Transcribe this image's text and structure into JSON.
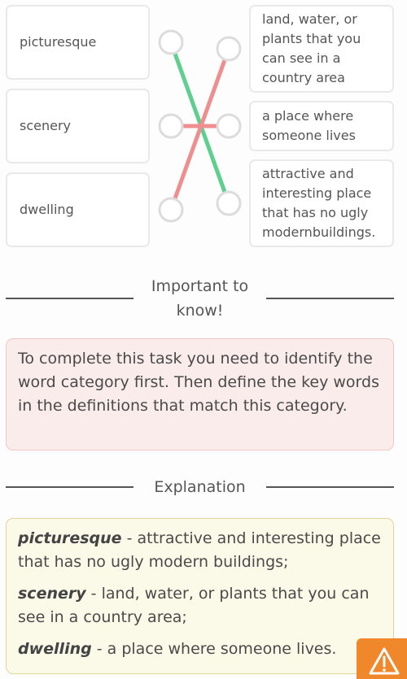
{
  "matching": {
    "terms": [
      {
        "label": "picturesque"
      },
      {
        "label": "scenery"
      },
      {
        "label": "dwelling"
      }
    ],
    "definitions": [
      {
        "label": "land, water, or plants that you can see in a country area"
      },
      {
        "label": "a place where someone lives"
      },
      {
        "label": "attractive and interesting place that has no ugly modernbuildings."
      }
    ],
    "connections": [
      {
        "term": 0,
        "definition": 2,
        "status": "correct"
      },
      {
        "term": 1,
        "definition": 1,
        "status": "incorrect"
      },
      {
        "term": 2,
        "definition": 0,
        "status": "incorrect"
      }
    ],
    "colors": {
      "correct": "#5fcf8f",
      "incorrect": "#ee8e8e"
    }
  },
  "important": {
    "heading": "Important to know!",
    "text": "To complete this task you need to identify the word category first. Then define the key words in the definitions that match this category."
  },
  "explanation": {
    "heading": "Explanation",
    "items": [
      {
        "term": "picturesque",
        "definition": " - attractive and interesting place that has no ugly modern buildings;"
      },
      {
        "term": "scenery",
        "definition": " - land, water, or plants that you can see in a country area;"
      },
      {
        "term": "dwelling",
        "definition": " - a place where someone lives."
      }
    ]
  },
  "report_button": {
    "icon": "warning-triangle-icon",
    "color": "#f0872b"
  }
}
